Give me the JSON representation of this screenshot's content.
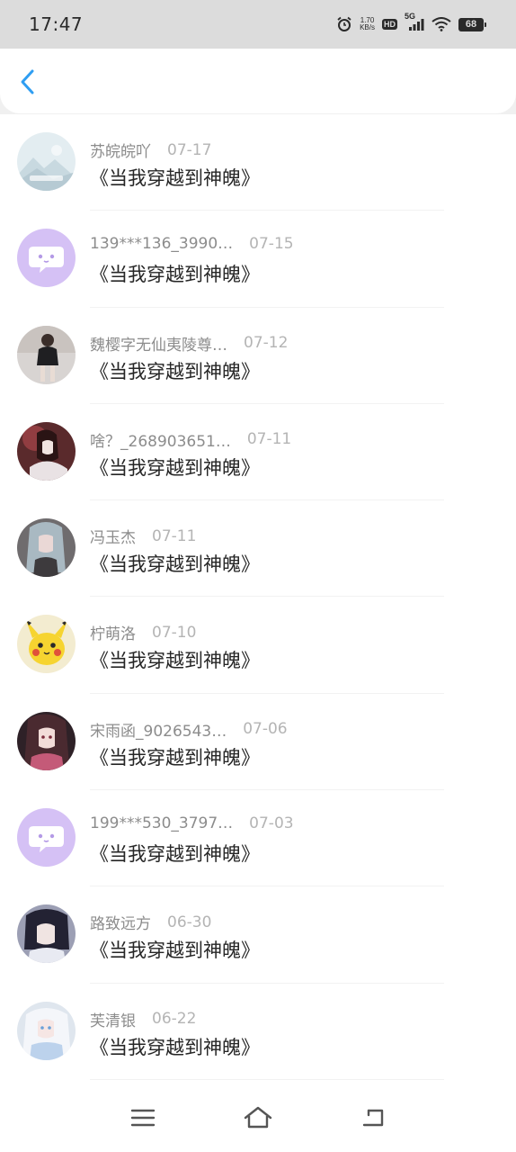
{
  "status_bar": {
    "time": "17:47",
    "net_speed_value": "1.70",
    "net_speed_unit": "KB/s",
    "hd_label": "HD",
    "network_label": "5G",
    "battery_level": "68"
  },
  "header": {
    "back_icon": "chevron-left-icon",
    "accent_color": "#2f9ef2"
  },
  "list": {
    "items": [
      {
        "name": "苏皖皖吖",
        "date": "07-17",
        "title": "《当我穿越到神魄》",
        "avatar": "landscape-placeholder"
      },
      {
        "name": "139***136_3990…",
        "date": "07-15",
        "title": "《当我穿越到神魄》",
        "avatar": "default-chat-avatar"
      },
      {
        "name": "魏樱字无仙夷陵尊…",
        "date": "07-12",
        "title": "《当我穿越到神魄》",
        "avatar": "photo"
      },
      {
        "name": "啥？_268903651…",
        "date": "07-11",
        "title": "《当我穿越到神魄》",
        "avatar": "photo"
      },
      {
        "name": "冯玉杰",
        "date": "07-11",
        "title": "《当我穿越到神魄》",
        "avatar": "photo"
      },
      {
        "name": "柠萌洛",
        "date": "07-10",
        "title": "《当我穿越到神魄》",
        "avatar": "photo"
      },
      {
        "name": "宋雨函_9026543…",
        "date": "07-06",
        "title": "《当我穿越到神魄》",
        "avatar": "photo"
      },
      {
        "name": "199***530_3797…",
        "date": "07-03",
        "title": "《当我穿越到神魄》",
        "avatar": "default-chat-avatar"
      },
      {
        "name": "路致远方",
        "date": "06-30",
        "title": "《当我穿越到神魄》",
        "avatar": "photo"
      },
      {
        "name": "芙清银",
        "date": "06-22",
        "title": "《当我穿越到神魄》",
        "avatar": "photo"
      }
    ]
  },
  "nav_bar": {
    "menu_icon": "menu-icon",
    "home_icon": "home-icon",
    "back_icon": "back-icon"
  }
}
